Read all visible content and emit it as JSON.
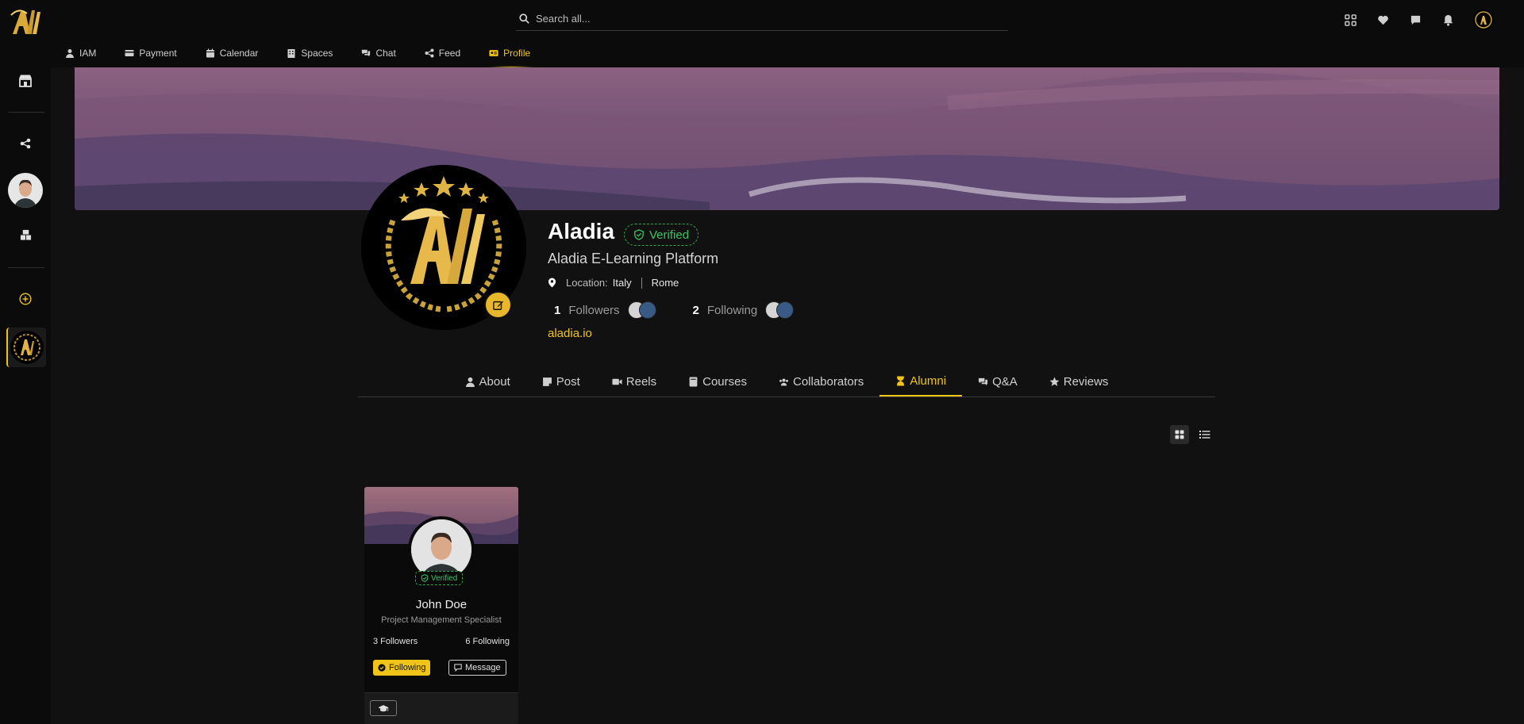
{
  "search": {
    "placeholder": "Search all..."
  },
  "nav": [
    {
      "label": "IAM",
      "icon": "user-icon"
    },
    {
      "label": "Payment",
      "icon": "credit-card-icon"
    },
    {
      "label": "Calendar",
      "icon": "calendar-icon"
    },
    {
      "label": "Spaces",
      "icon": "building-icon"
    },
    {
      "label": "Chat",
      "icon": "chat-icon"
    },
    {
      "label": "Feed",
      "icon": "share-icon"
    },
    {
      "label": "Profile",
      "icon": "id-card-icon",
      "active": true
    }
  ],
  "profile": {
    "name": "Aladia",
    "verified": "Verified",
    "subtitle": "Aladia E-Learning Platform",
    "location_label": "Location:",
    "country": "Italy",
    "city": "Rome",
    "followers_count": "1",
    "followers_label": "Followers",
    "following_count": "2",
    "following_label": "Following",
    "website": "aladia.io"
  },
  "tabs": [
    {
      "label": "About",
      "icon": "user-icon"
    },
    {
      "label": "Post",
      "icon": "note-icon"
    },
    {
      "label": "Reels",
      "icon": "video-icon"
    },
    {
      "label": "Courses",
      "icon": "book-icon"
    },
    {
      "label": "Collaborators",
      "icon": "users-icon"
    },
    {
      "label": "Alumni",
      "icon": "hourglass-icon",
      "active": true
    },
    {
      "label": "Q&A",
      "icon": "comments-icon"
    },
    {
      "label": "Reviews",
      "icon": "star-icon"
    }
  ],
  "alumni": [
    {
      "verified": "Verified",
      "name": "John Doe",
      "role": "Project Management Specialist",
      "followers": "3 Followers",
      "following": "6 Following",
      "following_button": "Following",
      "message_button": "Message"
    }
  ],
  "colors": {
    "accent": "#f0c419",
    "verified": "#3cc462",
    "background": "#111111"
  }
}
